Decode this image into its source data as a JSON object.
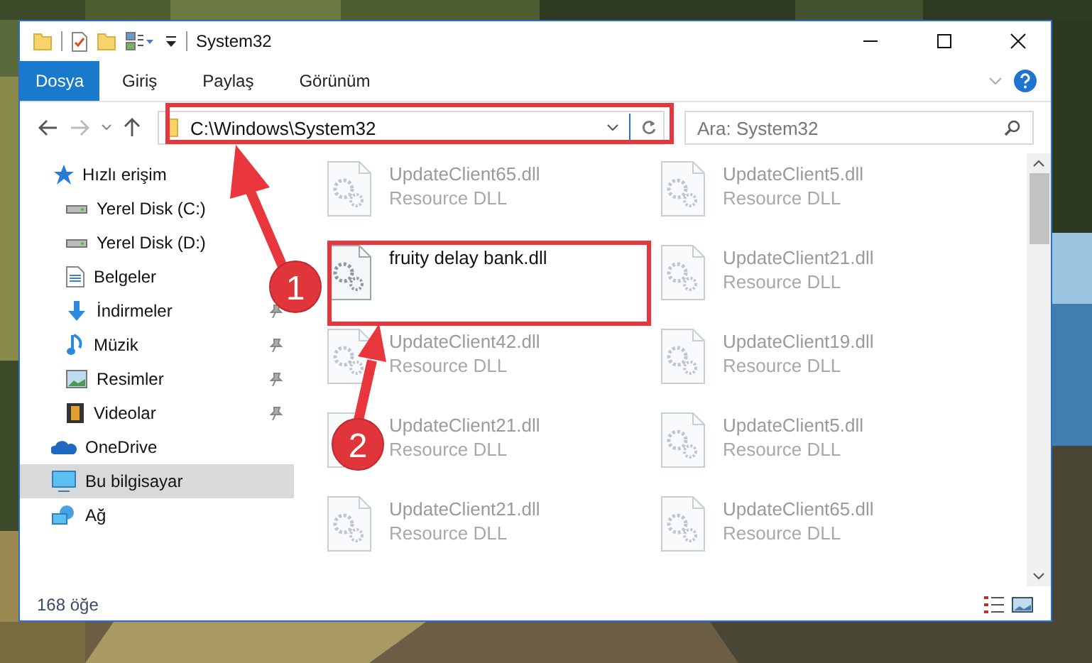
{
  "window": {
    "title": "System32"
  },
  "ribbon_tabs": [
    {
      "label": "Dosya",
      "selected": true
    },
    {
      "label": "Giriş",
      "selected": false
    },
    {
      "label": "Paylaş",
      "selected": false
    },
    {
      "label": "Görünüm",
      "selected": false
    }
  ],
  "address": {
    "path": "C:\\Windows\\System32"
  },
  "search": {
    "placeholder": "Ara: System32"
  },
  "nav": [
    {
      "label": "Hızlı erişim",
      "kind": "quick",
      "selected": false,
      "children": [
        {
          "label": "Yerel Disk (C:)",
          "kind": "drive",
          "pinned": false
        },
        {
          "label": "Yerel Disk (D:)",
          "kind": "drive",
          "pinned": false
        },
        {
          "label": "Belgeler",
          "kind": "docs",
          "pinned": false
        },
        {
          "label": "İndirmeler",
          "kind": "downloads",
          "pinned": true
        },
        {
          "label": "Müzik",
          "kind": "music",
          "pinned": true
        },
        {
          "label": "Resimler",
          "kind": "pictures",
          "pinned": true
        },
        {
          "label": "Videolar",
          "kind": "videos",
          "pinned": true
        }
      ]
    },
    {
      "label": "OneDrive",
      "kind": "cloud",
      "selected": false
    },
    {
      "label": "Bu bilgisayar",
      "kind": "pc",
      "selected": true
    },
    {
      "label": "Ağ",
      "kind": "network",
      "selected": false
    }
  ],
  "files": [
    {
      "name": "UpdateClient65.dll",
      "type": "Resource DLL",
      "selected": false
    },
    {
      "name": "UpdateClient5.dll",
      "type": "Resource DLL",
      "selected": false
    },
    {
      "name": "fruity delay bank.dll",
      "selected": true
    },
    {
      "name": "UpdateClient21.dll",
      "type": "Resource DLL",
      "selected": false
    },
    {
      "name": "UpdateClient42.dll",
      "type": "Resource DLL",
      "selected": false
    },
    {
      "name": "UpdateClient19.dll",
      "type": "Resource DLL",
      "selected": false
    },
    {
      "name": "UpdateClient21.dll",
      "type": "Resource DLL",
      "selected": false
    },
    {
      "name": "UpdateClient5.dll",
      "type": "Resource DLL",
      "selected": false
    },
    {
      "name": "UpdateClient21.dll",
      "type": "Resource DLL",
      "selected": false
    },
    {
      "name": "UpdateClient65.dll",
      "type": "Resource DLL",
      "selected": false
    }
  ],
  "status_bar": {
    "count": "168 öğe"
  },
  "annotations": [
    {
      "number": "1"
    },
    {
      "number": "2"
    }
  ]
}
